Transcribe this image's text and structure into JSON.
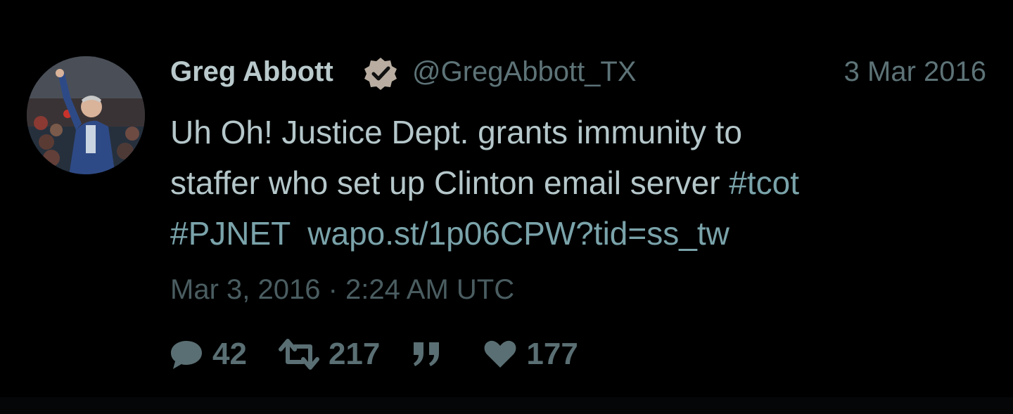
{
  "tweet": {
    "display_name": "Greg Abbott",
    "handle": "@GregAbbott_TX",
    "short_date": "3 Mar 2016",
    "body": {
      "line1": "Uh Oh! Justice Dept. grants immunity to",
      "line2_text": "staffer who set up Clinton email server ",
      "hashtag_tcot": "#tcot",
      "hashtag_pjnet": "#PJNET",
      "link": "wapo.st/1p06CPW?tid=ss_tw"
    },
    "timestamp": "Mar 3, 2016 · 2:24 AM UTC",
    "actions": {
      "replies": "42",
      "retweets": "217",
      "likes": "177"
    }
  },
  "colors": {
    "background": "#000000",
    "name": "#b9c9cc",
    "muted": "#5d7377",
    "link": "#7aa3aa",
    "verified_badge": "#b8ada0"
  },
  "icons": {
    "verified": "verified-badge-icon",
    "reply": "reply-icon",
    "retweet": "retweet-icon",
    "quote": "quote-icon",
    "like": "heart-icon"
  }
}
